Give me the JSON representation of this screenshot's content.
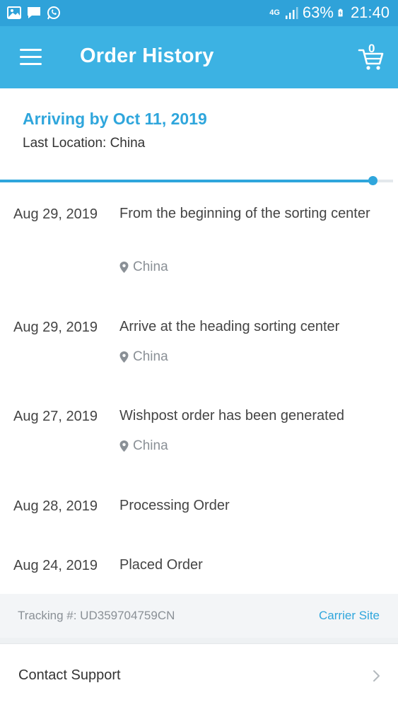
{
  "status_bar": {
    "network": "4G",
    "battery": "63%",
    "time": "21:40",
    "icons": [
      "gallery-icon",
      "message-icon",
      "whatsapp-icon"
    ]
  },
  "app_bar": {
    "title": "Order History",
    "cart_count": "0"
  },
  "summary": {
    "arriving": "Arriving by Oct 11, 2019",
    "last_location": "Last Location: China",
    "progress": 0.95
  },
  "events": [
    {
      "date": "Aug 29, 2019",
      "text": "From the beginning of the sorting center",
      "location": "China"
    },
    {
      "date": "Aug 29, 2019",
      "text": "Arrive at the heading sorting center",
      "location": "China"
    },
    {
      "date": "Aug 27, 2019",
      "text": "Wishpost order has been generated",
      "location": "China"
    },
    {
      "date": "Aug 28, 2019",
      "text": "Processing Order",
      "location": ""
    },
    {
      "date": "Aug 24, 2019",
      "text": "Placed Order",
      "location": ""
    }
  ],
  "tracking": {
    "number": "Tracking #: UD359704759CN",
    "carrier_link": "Carrier Site"
  },
  "support": {
    "label": "Contact Support"
  },
  "colors": {
    "status_bar": "#2fa2d9",
    "app_bar": "#3cb2e3",
    "accent": "#2fa6dc"
  }
}
